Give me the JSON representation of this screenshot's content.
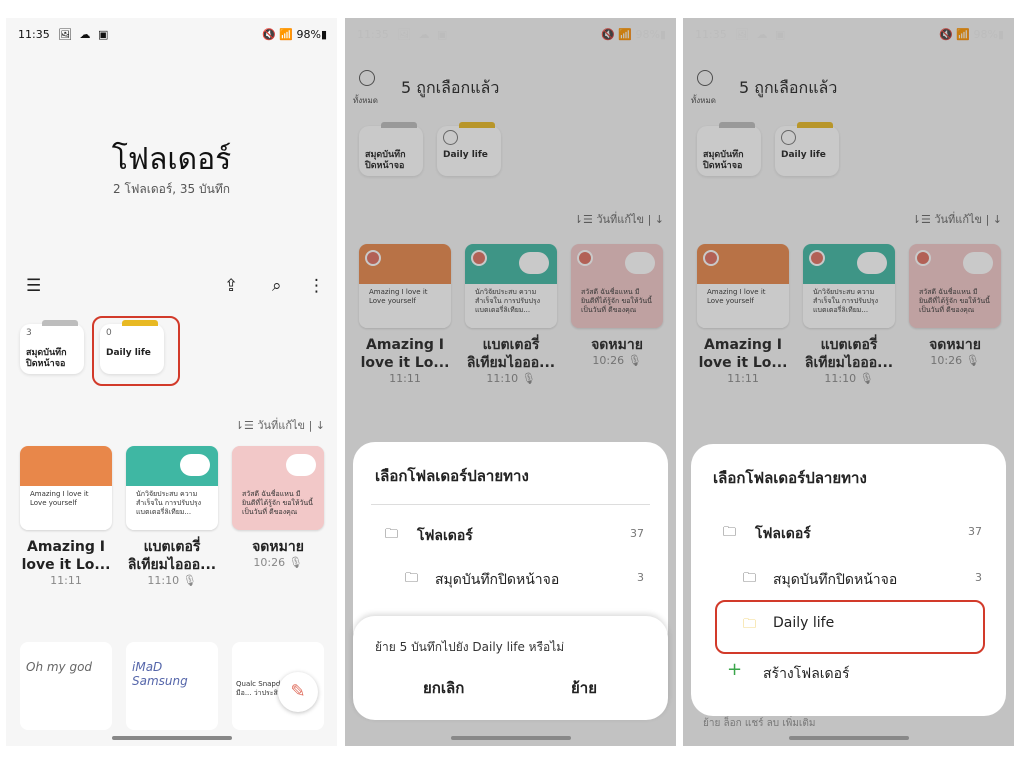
{
  "status": {
    "time": "11:35",
    "icons": "🖼 ☁ ▣",
    "right": "🔇 📶 98%▮"
  },
  "panel1": {
    "title": "โฟลเดอร์",
    "subtitle": "2 โฟลเดอร์, 35 บันทึก",
    "menu_icon": "☰",
    "pdf_icon": "⇪",
    "search_icon": "⌕",
    "more_icon": "⋮",
    "folders": [
      {
        "count": "3",
        "label": "สมุดบันทึก ปิดหน้าจอ"
      },
      {
        "count": "0",
        "label": "Daily life"
      }
    ],
    "sort_label": "⇂☰ วันที่แก้ไข  |  ↓",
    "notes": [
      {
        "title": "Amazing I love it Lo...",
        "sub": "11:11",
        "preview": "Amazing I love it Love yourself"
      },
      {
        "title": "แบตเตอรี่ ลิเทียมไอออ...",
        "sub": "11:10 🎙",
        "preview": "นักวิจัยประสบ ความสำเร็จใน การปรับปรุง แบตเตอรี่ลิเทียม..."
      },
      {
        "title": "จดหมาย",
        "sub": "10:26 🎙",
        "preview": "สวัสดี ฉันชื่อแหน มี ยินดีที่ได้รู้จัก ขอให้วันนี้เป็นวันที่ ดีของคุณ"
      }
    ],
    "sketches": [
      "Oh my god",
      "iMaD Samsung",
      "Qualc Snapd Gen 4 มีอ... ว่าประสิทธิภาพ..."
    ]
  },
  "panel2": {
    "select_all": "ทั้งหมด",
    "selected_label": "5 ถูกเลือกแล้ว",
    "folder_a": "สมุดบันทึก ปิดหน้าจอ",
    "folder_b": "Daily life",
    "sort_label": "⇂☰ วันที่แก้ไข  |  ↓",
    "sheet_title": "เลือกโฟลเดอร์ปลายทาง",
    "root_folder": "โฟลเดอร์",
    "root_count": "37",
    "sub_folder": "สมุดบันทึกปิดหน้าจอ",
    "sub_count": "3",
    "confirm_text": "ย้าย 5 บันทึกไปยัง Daily life หรือไม่",
    "cancel": "ยกเลิก",
    "move": "ย้าย"
  },
  "panel3": {
    "sheet_title": "เลือกโฟลเดอร์ปลายทาง",
    "root_folder": "โฟลเดอร์",
    "root_count": "37",
    "sub_folder": "สมุดบันทึกปิดหน้าจอ",
    "sub_count": "3",
    "daily": "Daily life",
    "create": "สร้างโฟลเดอร์",
    "bottom_bar": "ย้าย   ล็อก   แชร์   ลบ   เพิ่มเติม"
  },
  "colors": {
    "accent_red": "#d23a2a",
    "folder_gray": "#bdbdbd",
    "folder_yellow": "#e8b923"
  }
}
